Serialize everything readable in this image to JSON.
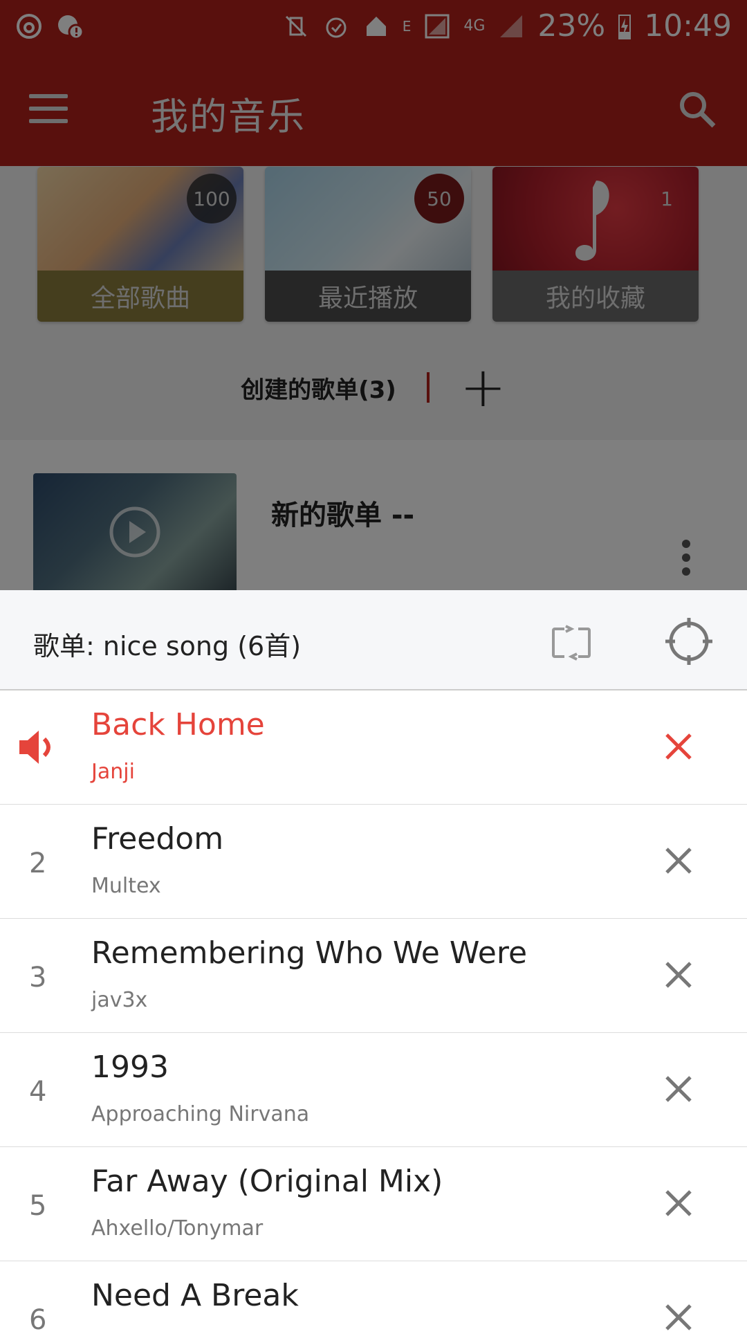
{
  "status_bar": {
    "battery": "23%",
    "time": "10:49",
    "network": "4G",
    "signal_label": "E"
  },
  "app_bar": {
    "title": "我的音乐"
  },
  "cards": [
    {
      "label": "全部歌曲",
      "count": "100"
    },
    {
      "label": "最近播放",
      "count": "50"
    },
    {
      "label": "我的收藏",
      "count": "1"
    }
  ],
  "section": {
    "title": "创建的歌单(3)"
  },
  "playlist": {
    "name": "新的歌单 --"
  },
  "sheet": {
    "title": "歌单: nice song (6首)"
  },
  "songs": [
    {
      "num": "",
      "title": "Back Home",
      "artist": "Janji",
      "current": true
    },
    {
      "num": "2",
      "title": "Freedom",
      "artist": "Multex"
    },
    {
      "num": "3",
      "title": "Remembering Who We Were",
      "artist": "jav3x"
    },
    {
      "num": "4",
      "title": "1993",
      "artist": "Approaching Nirvana"
    },
    {
      "num": "5",
      "title": "Far Away (Original Mix)",
      "artist": "Ahxello/Tonymar"
    },
    {
      "num": "6",
      "title": "Need A Break",
      "artist": ""
    }
  ],
  "colors": {
    "brand": "#b3211b",
    "accent": "#e5443b"
  }
}
